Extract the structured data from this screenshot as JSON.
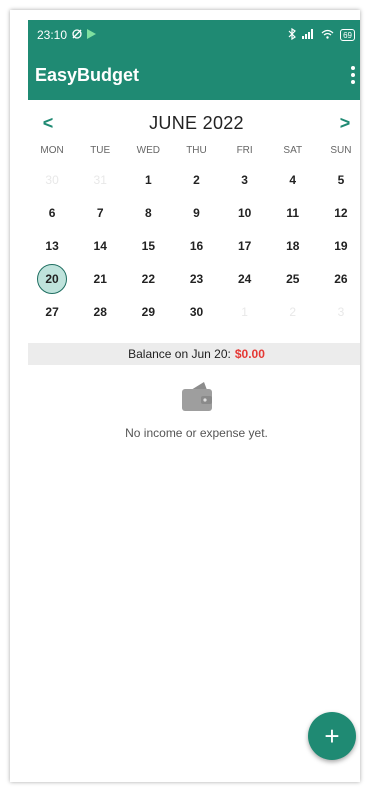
{
  "status_bar": {
    "time": "23:10",
    "battery": "69"
  },
  "app_bar": {
    "title": "EasyBudget",
    "menu_icon": "overflow-menu-icon"
  },
  "calendar": {
    "month_title": "JUNE 2022",
    "prev_label": "<",
    "next_label": ">",
    "weekdays": [
      "MON",
      "TUE",
      "WED",
      "THU",
      "FRI",
      "SAT",
      "SUN"
    ],
    "weeks": [
      [
        "30",
        "31",
        "1",
        "2",
        "3",
        "4",
        "5"
      ],
      [
        "6",
        "7",
        "8",
        "9",
        "10",
        "11",
        "12"
      ],
      [
        "13",
        "14",
        "15",
        "16",
        "17",
        "18",
        "19"
      ],
      [
        "20",
        "21",
        "22",
        "23",
        "24",
        "25",
        "26"
      ],
      [
        "27",
        "28",
        "29",
        "30",
        "1",
        "2",
        "3"
      ]
    ],
    "selected_day": "20"
  },
  "balance": {
    "label": "Balance on Jun 20:",
    "amount": "$0.00",
    "amount_color": "#e53935"
  },
  "empty_state": {
    "icon": "wallet-icon",
    "message": "No income or expense yet."
  },
  "fab": {
    "label": "+",
    "icon": "add-icon"
  },
  "colors": {
    "primary": "#1f8a73",
    "selected_fill": "#bfe3dc"
  }
}
